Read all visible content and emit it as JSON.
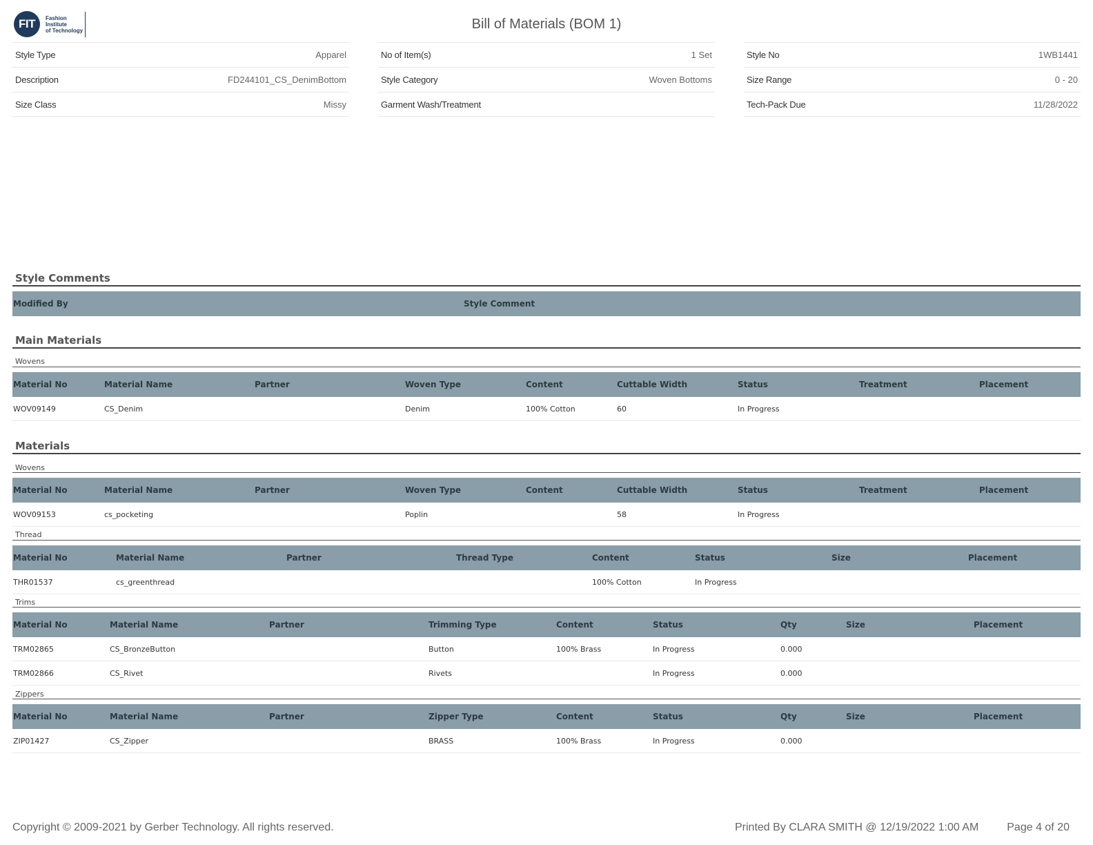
{
  "logo": {
    "mark": "FIT",
    "line1": "Fashion Institute",
    "line2": "of Technology"
  },
  "title": "Bill of Materials (BOM 1)",
  "header": {
    "col1": [
      {
        "label": "Style Type",
        "value": "Apparel"
      },
      {
        "label": "Description",
        "value": "FD244101_CS_DenimBottom"
      },
      {
        "label": "Size Class",
        "value": "Missy"
      }
    ],
    "col2": [
      {
        "label": "No of Item(s)",
        "value": "1 Set"
      },
      {
        "label": "Style Category",
        "value": "Woven Bottoms"
      },
      {
        "label": "Garment Wash/Treatment",
        "value": ""
      }
    ],
    "col3": [
      {
        "label": "Style No",
        "value": "1WB1441"
      },
      {
        "label": "Size Range",
        "value": "0 - 20"
      },
      {
        "label": "Tech-Pack Due",
        "value": "11/28/2022"
      }
    ]
  },
  "style_comments": {
    "title": "Style Comments",
    "columns": [
      "Modified By",
      "Style Comment"
    ]
  },
  "main_materials": {
    "title": "Main Materials",
    "wovens": {
      "title": "Wovens",
      "columns": [
        "Material No",
        "Material Name",
        "Partner",
        "Woven Type",
        "Content",
        "Cuttable Width",
        "Status",
        "Treatment",
        "Placement"
      ],
      "rows": [
        [
          "WOV09149",
          "CS_Denim",
          "",
          "Denim",
          "100% Cotton",
          "60",
          "In Progress",
          "",
          ""
        ]
      ]
    }
  },
  "materials": {
    "title": "Materials",
    "wovens": {
      "title": "Wovens",
      "columns": [
        "Material No",
        "Material Name",
        "Partner",
        "Woven Type",
        "Content",
        "Cuttable Width",
        "Status",
        "Treatment",
        "Placement"
      ],
      "rows": [
        [
          "WOV09153",
          "cs_pocketing",
          "",
          "Poplin",
          "",
          "58",
          "In Progress",
          "",
          ""
        ]
      ]
    },
    "thread": {
      "title": "Thread",
      "columns": [
        "Material No",
        "Material Name",
        "Partner",
        "Thread Type",
        "Content",
        "Status",
        "Size",
        "Placement"
      ],
      "rows": [
        [
          "THR01537",
          "cs_greenthread",
          "",
          "",
          "100% Cotton",
          "In Progress",
          "",
          ""
        ]
      ]
    },
    "trims": {
      "title": "Trims",
      "columns": [
        "Material No",
        "Material Name",
        "Partner",
        "Trimming Type",
        "Content",
        "Status",
        "Qty",
        "Size",
        "Placement"
      ],
      "rows": [
        [
          "TRM02865",
          "CS_BronzeButton",
          "",
          "Button",
          "100% Brass",
          "In Progress",
          "0.000",
          "",
          ""
        ],
        [
          "TRM02866",
          "CS_Rivet",
          "",
          "Rivets",
          "",
          "In Progress",
          "0.000",
          "",
          ""
        ]
      ]
    },
    "zippers": {
      "title": "Zippers",
      "columns": [
        "Material No",
        "Material Name",
        "Partner",
        "Zipper Type",
        "Content",
        "Status",
        "Qty",
        "Size",
        "Placement"
      ],
      "rows": [
        [
          "ZIP01427",
          "CS_Zipper",
          "",
          "BRASS",
          "100% Brass",
          "In Progress",
          "0.000",
          "",
          ""
        ]
      ]
    }
  },
  "footer": {
    "copyright": "Copyright © 2009-2021 by Gerber Technology. All rights reserved.",
    "printed": "Printed By CLARA SMITH @ 12/19/2022 1:00 AM",
    "page": "Page 4 of 20"
  }
}
